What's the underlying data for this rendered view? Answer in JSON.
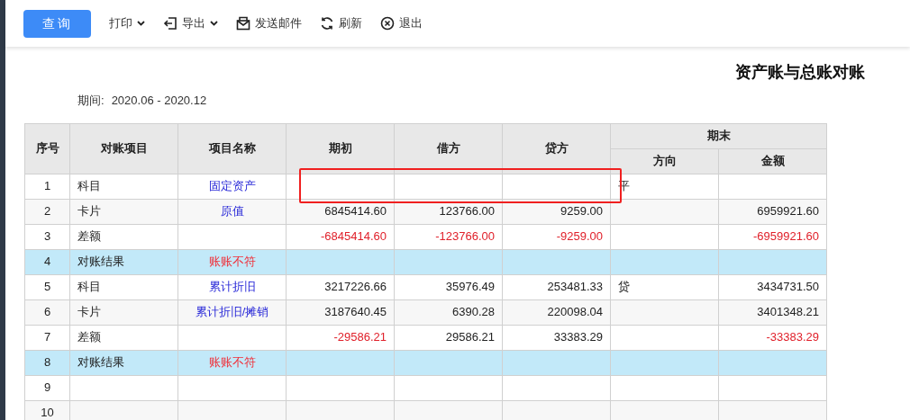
{
  "toolbar": {
    "query_button": "查询",
    "items": [
      {
        "kind": "print",
        "label": "打印",
        "dropdown": true
      },
      {
        "kind": "export",
        "label": "导出",
        "dropdown": true
      },
      {
        "kind": "mail",
        "label": "发送邮件",
        "dropdown": false
      },
      {
        "kind": "refresh",
        "label": "刷新",
        "dropdown": false
      },
      {
        "kind": "exit",
        "label": "退出",
        "dropdown": false
      }
    ]
  },
  "report": {
    "title": "资产账与总账对账",
    "period_label": "期间:",
    "period": "2020.06 - 2020.12"
  },
  "table": {
    "columns": [
      "序号",
      "对账项目",
      "项目名称",
      "期初",
      "借方",
      "贷方"
    ],
    "group_header": "期末",
    "sub_columns": [
      "方向",
      "金额"
    ],
    "rows": [
      {
        "kind": "normal",
        "no": "1",
        "item": "科目",
        "name": "固定资产",
        "direction": "平"
      },
      {
        "kind": "normal",
        "no": "2",
        "item": "卡片",
        "name": "原值",
        "opening": {
          "text": "6845414.60",
          "negative": false
        },
        "debit": {
          "text": "123766.00",
          "negative": false
        },
        "credit": {
          "text": "9259.00",
          "negative": false
        },
        "amount": {
          "text": "6959921.60",
          "negative": false
        }
      },
      {
        "kind": "normal",
        "no": "3",
        "item": "差额",
        "opening": {
          "text": "-6845414.60",
          "negative": true
        },
        "debit": {
          "text": "-123766.00",
          "negative": true
        },
        "credit": {
          "text": "-9259.00",
          "negative": true
        },
        "amount": {
          "text": "-6959921.60",
          "negative": true
        }
      },
      {
        "kind": "result",
        "no": "4",
        "item": "对账结果",
        "name": "账账不符"
      },
      {
        "kind": "normal",
        "no": "5",
        "item": "科目",
        "name": "累计折旧",
        "opening": {
          "text": "3217226.66",
          "negative": false
        },
        "debit": {
          "text": "35976.49",
          "negative": false
        },
        "credit": {
          "text": "253481.33",
          "negative": false
        },
        "direction": "贷",
        "amount": {
          "text": "3434731.50",
          "negative": false
        }
      },
      {
        "kind": "normal",
        "no": "6",
        "item": "卡片",
        "name": "累计折旧/摊销",
        "opening": {
          "text": "3187640.45",
          "negative": false
        },
        "debit": {
          "text": "6390.28",
          "negative": false
        },
        "credit": {
          "text": "220098.04",
          "negative": false
        },
        "amount": {
          "text": "3401348.21",
          "negative": false
        }
      },
      {
        "kind": "normal",
        "no": "7",
        "item": "差额",
        "opening": {
          "text": "-29586.21",
          "negative": true
        },
        "debit": {
          "text": "29586.21",
          "negative": false
        },
        "credit": {
          "text": "33383.29",
          "negative": false
        },
        "amount": {
          "text": "-33383.29",
          "negative": true
        }
      },
      {
        "kind": "result",
        "no": "8",
        "item": "对账结果",
        "name": "账账不符"
      },
      {
        "kind": "normal",
        "no": "9"
      },
      {
        "kind": "normal",
        "no": "10"
      }
    ]
  }
}
